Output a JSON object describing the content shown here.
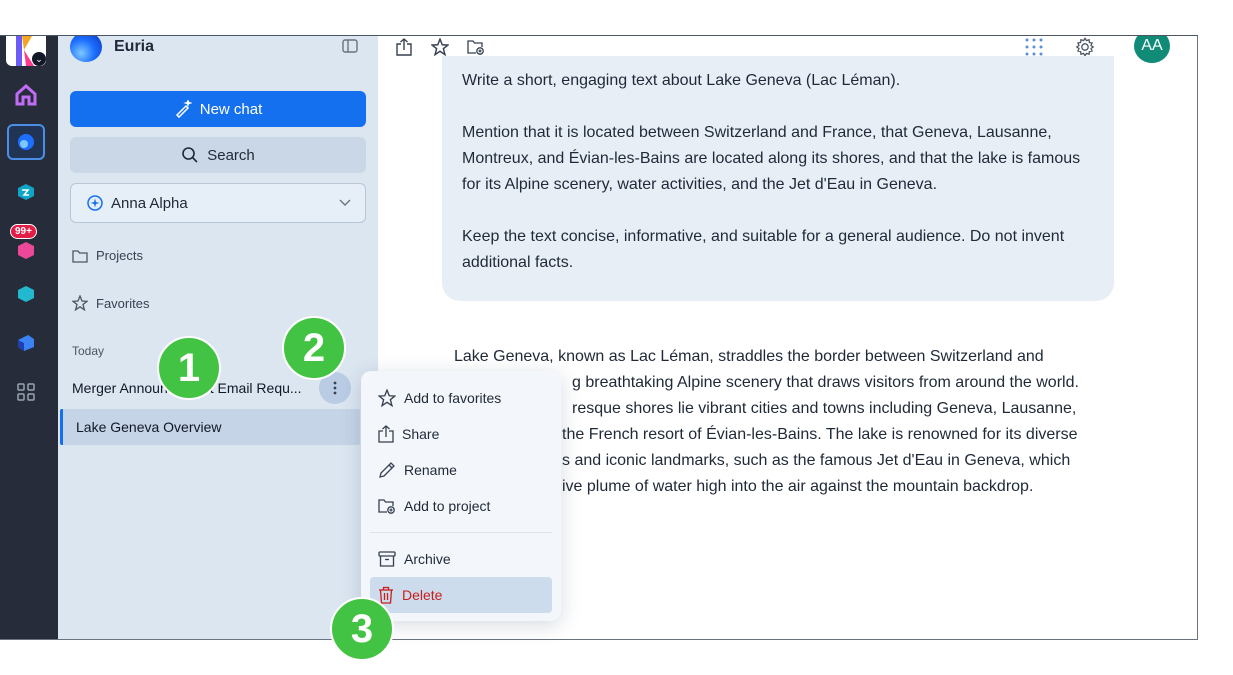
{
  "rail": {
    "logo_badge": "⌄",
    "notification_badge": "99+"
  },
  "sidebar": {
    "brand": "Euria",
    "new_chat_label": "New chat",
    "search_label": "Search",
    "model_label": "Anna Alpha",
    "projects_label": "Projects",
    "favorites_label": "Favorites",
    "today_label": "Today",
    "conversations": [
      {
        "title": "Merger Announcement Email Requ..."
      },
      {
        "title": "Lake Geneva Overview"
      }
    ]
  },
  "header": {
    "avatar_initials": "AA"
  },
  "chat": {
    "prompt_paragraphs": [
      "Write a short, engaging text about Lake Geneva (Lac Léman).",
      "Mention that it is located between Switzerland and France, that Geneva, Lausanne, Montreux, and Évian-les-Bains are located along its shores, and that the lake is famous for its Alpine scenery, water activities, and the Jet d'Eau in Geneva.",
      "Keep the text concise, informative, and suitable for a general audience. Do not invent additional facts."
    ],
    "answer_lines": [
      "Lake Geneva, known as Lac Léman, straddles the border between Switzerland and",
      "g breathtaking Alpine scenery that draws visitors from around the world.",
      "resque shores lie vibrant cities and towns including Geneva, Lausanne,",
      "the French resort of Évian-les-Bains. The lake is renowned for its diverse",
      "s and iconic landmarks, such as the famous Jet d'Eau in Geneva, which",
      "ive plume of water high into the air against the mountain backdrop."
    ]
  },
  "context_menu": {
    "items": [
      {
        "label": "Add to favorites",
        "icon": "star-icon"
      },
      {
        "label": "Share",
        "icon": "share-icon"
      },
      {
        "label": "Rename",
        "icon": "pencil-icon"
      },
      {
        "label": "Add to project",
        "icon": "folder-add-icon"
      },
      {
        "label": "Archive",
        "icon": "archive-icon"
      },
      {
        "label": "Delete",
        "icon": "trash-icon"
      }
    ]
  },
  "steps": [
    "1",
    "2",
    "3"
  ],
  "colors": {
    "accent": "#1570ef",
    "danger": "#c81e1e",
    "step_marker": "#43c343",
    "avatar": "#0f8b78"
  }
}
